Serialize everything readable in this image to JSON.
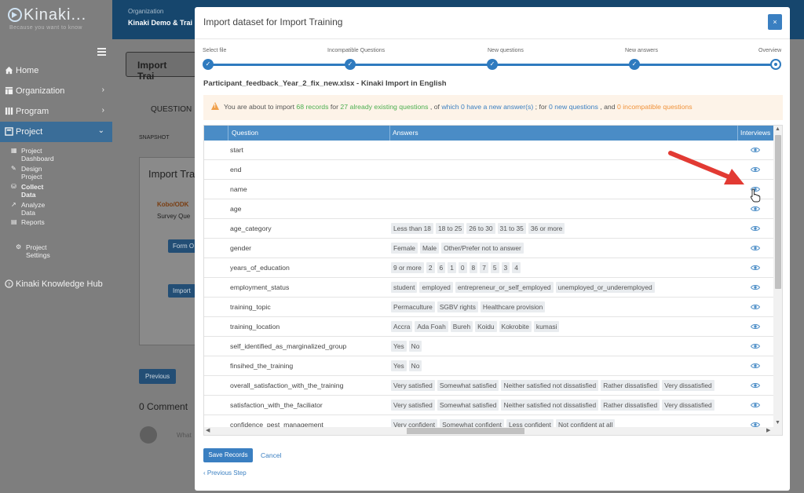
{
  "brand": {
    "name": "Kinaki...",
    "tagline": "Because you want to know"
  },
  "sidebar": {
    "items": [
      {
        "label": "Home",
        "icon": "home-icon"
      },
      {
        "label": "Organization",
        "icon": "organization-icon"
      },
      {
        "label": "Program",
        "icon": "program-icon"
      },
      {
        "label": "Project",
        "icon": "project-icon"
      }
    ],
    "sub_items": [
      {
        "label": "Project Dashboard"
      },
      {
        "label": "Design Project"
      },
      {
        "label": "Collect Data"
      },
      {
        "label": "Analyze Data"
      },
      {
        "label": "Reports"
      },
      {
        "label": "Project Settings"
      }
    ],
    "knowledge_hub": "Kinaki Knowledge Hub"
  },
  "topbar": {
    "org_label": "Organization",
    "org_name": "Kinaki Demo & Trai"
  },
  "background": {
    "import_title": "Import Trai",
    "questions_tab": "QUESTION",
    "snapshot": "SNAPSHOT",
    "panel_title": "Import Tra",
    "kobo": "Kobo/ODK",
    "survey": "Survey Que",
    "form_btn": "Form O",
    "import_btn": "Import",
    "previous_btn": "Previous",
    "comments": "0 Comment",
    "comment_placeholder": "What"
  },
  "modal": {
    "title": "Import dataset for Import Training",
    "close": "×",
    "steps": [
      "Select file",
      "Incompatible Questions",
      "New questions",
      "New answers",
      "Overview"
    ],
    "filename": "Participant_feedback_Year_2_fix_new.xlsx - Kinaki Import in English",
    "alert": {
      "p1": "You are about to import ",
      "records": "68 records",
      "p2": " for ",
      "existing": "27 already existing questions",
      "p3": " , of ",
      "new_answers": "which 0 have a new answer(s)",
      "p4": " ; for ",
      "new_questions": "0 new questions",
      "p5": " , and ",
      "incompatible": "0 incompatible questions"
    },
    "table": {
      "headers": {
        "question": "Question",
        "answers": "Answers",
        "interviews": "Interviews"
      },
      "rows": [
        {
          "q": "start",
          "a": []
        },
        {
          "q": "end",
          "a": []
        },
        {
          "q": "name",
          "a": []
        },
        {
          "q": "age",
          "a": []
        },
        {
          "q": "age_category",
          "a": [
            "Less than 18",
            "18 to 25",
            "26 to 30",
            "31 to 35",
            "36 or more"
          ]
        },
        {
          "q": "gender",
          "a": [
            "Female",
            "Male",
            "Other/Prefer not to answer"
          ]
        },
        {
          "q": "years_of_education",
          "a": [
            "9 or more",
            "2",
            "6",
            "1",
            "0",
            "8",
            "7",
            "5",
            "3",
            "4"
          ]
        },
        {
          "q": "employment_status",
          "a": [
            "student",
            "employed",
            "entrepreneur_or_self_employed",
            "unemployed_or_underemployed"
          ]
        },
        {
          "q": "training_topic",
          "a": [
            "Permaculture",
            "SGBV rights",
            "Healthcare provision"
          ]
        },
        {
          "q": "training_location",
          "a": [
            "Accra",
            "Ada Foah",
            "Bureh",
            "Koidu",
            "Kokrobite",
            "kumasi"
          ]
        },
        {
          "q": "self_identified_as_marginalized_group",
          "a": [
            "Yes",
            "No"
          ]
        },
        {
          "q": "finsihed_the_training",
          "a": [
            "Yes",
            "No"
          ]
        },
        {
          "q": "overall_satisfaction_with_the_training",
          "a": [
            "Very satisfied",
            "Somewhat satisfied",
            "Neither satisfied not dissatisfied",
            "Rather dissatisfied",
            "Very dissatisfied"
          ]
        },
        {
          "q": "satisfaction_with_the_faciliator",
          "a": [
            "Very satisfied",
            "Somewhat satisfied",
            "Neither satisfied not dissatisfied",
            "Rather dissatisfied",
            "Very dissatisfied"
          ]
        },
        {
          "q": "confidence_pest_management",
          "a": [
            "Very confident",
            "Somewhat confident",
            "Less confident",
            "Not confident at all"
          ]
        }
      ]
    },
    "save": "Save Records",
    "cancel": "Cancel",
    "previous_step": "Previous Step"
  },
  "colors": {
    "accent": "#3a7fc1",
    "header": "#4a8cc6",
    "sidebar_active": "#3a6d98",
    "topbar": "#16466d",
    "green": "#4caf50",
    "orange": "#f0923a",
    "arrow": "#e23a33"
  }
}
